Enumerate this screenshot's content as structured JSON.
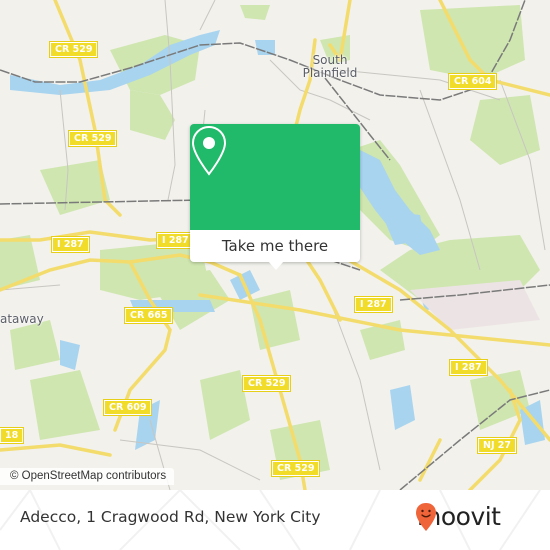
{
  "map": {
    "place_labels": {
      "south_plainfield": "South Plainfield",
      "piscataway_partial": "ataway"
    },
    "road_shields": [
      {
        "id": "cr529-a",
        "label": "CR 529"
      },
      {
        "id": "cr529-b",
        "label": "CR 529"
      },
      {
        "id": "cr604",
        "label": "CR 604"
      },
      {
        "id": "i287-a",
        "label": "I 287"
      },
      {
        "id": "i287-b",
        "label": "I 287"
      },
      {
        "id": "i287-c",
        "label": "I 287"
      },
      {
        "id": "i287-d",
        "label": "I 287"
      },
      {
        "id": "cr665",
        "label": "CR 665"
      },
      {
        "id": "cr529-c",
        "label": "CR 529"
      },
      {
        "id": "cr609",
        "label": "CR 609"
      },
      {
        "id": "cr18-partial",
        "label": "18"
      },
      {
        "id": "nj27",
        "label": "NJ 27"
      },
      {
        "id": "cr529-d",
        "label": "CR 529"
      }
    ],
    "attribution": "© OpenStreetMap contributors",
    "colors": {
      "land": "#f2f1ec",
      "park": "#cfe6b0",
      "water": "#a8d4ef",
      "road": "#f3dc6b",
      "rail": "#7a7a7a"
    }
  },
  "popup": {
    "button_label": "Take me there",
    "icon": "map-pin-icon",
    "color": "#21b96a"
  },
  "footer": {
    "address": "Adecco, 1 Cragwood Rd, New York City",
    "brand": "moovit",
    "brand_color": "#f0643a"
  }
}
